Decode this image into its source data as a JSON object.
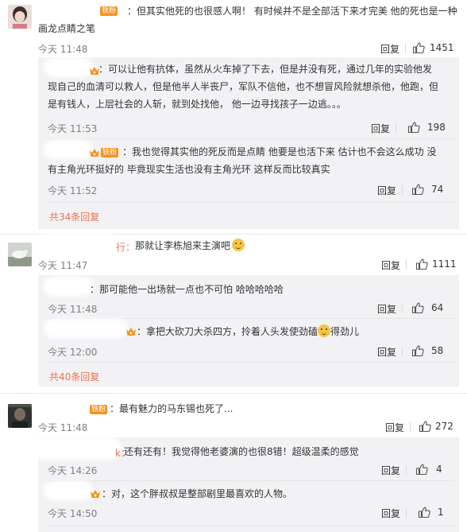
{
  "comments": [
    {
      "name_tail": "",
      "badge": "铁粉",
      "text_line1": "：但其实他死的也很感人啊！ 有时候并不是全部活下来才完美 他的死也是一种",
      "text_line2": "画龙点睛之笔",
      "time": "今天 11:48",
      "reply": "回复",
      "likes": "1451",
      "more": "",
      "subs": [
        {
          "name_tail": "",
          "text_line1": "：可以让他有抗体，虽然从火车掉了下去，但是并没有死，通过几年的实验他发",
          "text_line2": "现自己的血清可以救人，但是他半人半丧尸，军队不信他，也不想冒风险就想杀他，他跑，但",
          "text_line3": "是有钱人，上层社会的人斩，就到处找他， 他一边寻找孩子一边逃。。。",
          "time": "今天 11:53",
          "reply": "回复",
          "likes": "198"
        },
        {
          "name_tail": "",
          "badge": "铁粉",
          "text_line1": "：我也觉得其实他的死反而是点睛  他要是也活下来 估计也不会这么成功  没",
          "text_line2": "有主角光环挺好的 毕竟现实生活也没有主角光环 这样反而比较真实",
          "time": "今天 11:52",
          "reply": "回复",
          "likes": "74"
        }
      ],
      "more_link": "共34条回复"
    },
    {
      "name_tail": "行：",
      "text_line1": "那就让李栋旭来主演吧",
      "time": "今天 11:47",
      "reply": "回复",
      "likes": "1111",
      "subs": [
        {
          "name_tail": "",
          "text_line1": "：那可能他一出场就一点也不可怕 哈哈哈哈哈",
          "time": "今天 11:48",
          "reply": "回复",
          "likes": "64"
        },
        {
          "name_tail": "",
          "text_line1": "：拿把大砍刀大杀四方，拎着人头发使劲磕",
          "text_line1b": "得劲儿",
          "time": "今天 12:00",
          "reply": "回复",
          "likes": "58"
        }
      ],
      "more_link": "共40条回复"
    },
    {
      "name_tail": "",
      "badge": "铁粉",
      "text_line1": "：最有魅力的马东锡也死了...",
      "time": "今天 11:48",
      "reply": "回复",
      "likes": "272",
      "subs": [
        {
          "name_tail": "k：",
          "text_line1": "还有还有！我觉得他老婆演的也很8错！超级温柔的感觉",
          "time": "今天 14:26",
          "reply": "回复",
          "likes": "4"
        },
        {
          "name_tail": "",
          "text_line1": "：对，这个胖叔叔是整部剧里最喜欢的人物。",
          "time": "今天 14:50",
          "reply": "回复",
          "likes": "1"
        }
      ]
    }
  ],
  "colors": {
    "link": "#eb7350",
    "badge": "#f7931e",
    "subbox_bg": "#f2f2f5"
  },
  "icons": {
    "like": "thumbs-up-icon",
    "vip": "vip-crown-icon",
    "emoji": "grin-emoji-icon"
  }
}
